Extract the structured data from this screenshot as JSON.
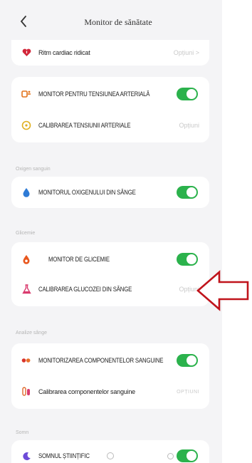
{
  "header": {
    "title": "Monitor de sănătate"
  },
  "heart": {
    "label": "Ritm cardiac ridicat",
    "option": "Opțiuni >"
  },
  "bp": {
    "monitor_label": "MONITOR PENTRU TENSIUNEA ARTERIALĂ",
    "calib_label": "CALIBRAREA TENSIUNII ARTERIALE",
    "calib_option": "Opțiuni"
  },
  "oxygen": {
    "section": "Oxigen sanguin",
    "monitor_label": "MONITORUL OXIGENULUI DIN SÂNGE"
  },
  "glucose": {
    "section": "Glicemie",
    "monitor_label": "MONITOR DE GLICEMIE",
    "calib_label": "CALIBRAREA GLUCOZEI DIN SÂNGE",
    "calib_option": "Opțiuni"
  },
  "blood": {
    "section": "Analize sânge",
    "monitor_label": "MONITORIZAREA COMPONENTELOR SANGUINE",
    "calib_label": "Calibrarea componentelor sanguine",
    "calib_option": "OPȚIUNI"
  },
  "sleep": {
    "section": "Somn",
    "monitor_label": "SOMNUL ȘTIINȚIFIC"
  },
  "toggles": {
    "bp": true,
    "oxygen": true,
    "glucose": true,
    "blood": true,
    "sleep": true
  },
  "colors": {
    "toggle_on": "#2bb24c",
    "arrow": "#c0141c",
    "background": "#f4f4f6"
  }
}
